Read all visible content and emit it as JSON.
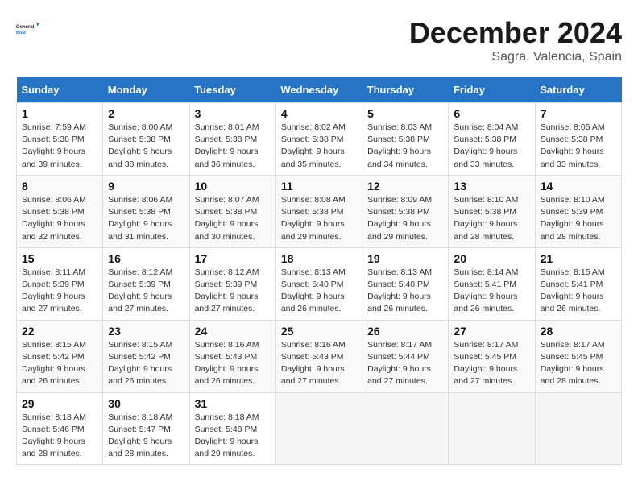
{
  "header": {
    "logo_line1": "General",
    "logo_line2": "Blue",
    "month": "December 2024",
    "location": "Sagra, Valencia, Spain"
  },
  "weekdays": [
    "Sunday",
    "Monday",
    "Tuesday",
    "Wednesday",
    "Thursday",
    "Friday",
    "Saturday"
  ],
  "weeks": [
    [
      {
        "day": "1",
        "info": "Sunrise: 7:59 AM\nSunset: 5:38 PM\nDaylight: 9 hours\nand 39 minutes."
      },
      {
        "day": "2",
        "info": "Sunrise: 8:00 AM\nSunset: 5:38 PM\nDaylight: 9 hours\nand 38 minutes."
      },
      {
        "day": "3",
        "info": "Sunrise: 8:01 AM\nSunset: 5:38 PM\nDaylight: 9 hours\nand 36 minutes."
      },
      {
        "day": "4",
        "info": "Sunrise: 8:02 AM\nSunset: 5:38 PM\nDaylight: 9 hours\nand 35 minutes."
      },
      {
        "day": "5",
        "info": "Sunrise: 8:03 AM\nSunset: 5:38 PM\nDaylight: 9 hours\nand 34 minutes."
      },
      {
        "day": "6",
        "info": "Sunrise: 8:04 AM\nSunset: 5:38 PM\nDaylight: 9 hours\nand 33 minutes."
      },
      {
        "day": "7",
        "info": "Sunrise: 8:05 AM\nSunset: 5:38 PM\nDaylight: 9 hours\nand 33 minutes."
      }
    ],
    [
      {
        "day": "8",
        "info": "Sunrise: 8:06 AM\nSunset: 5:38 PM\nDaylight: 9 hours\nand 32 minutes."
      },
      {
        "day": "9",
        "info": "Sunrise: 8:06 AM\nSunset: 5:38 PM\nDaylight: 9 hours\nand 31 minutes."
      },
      {
        "day": "10",
        "info": "Sunrise: 8:07 AM\nSunset: 5:38 PM\nDaylight: 9 hours\nand 30 minutes."
      },
      {
        "day": "11",
        "info": "Sunrise: 8:08 AM\nSunset: 5:38 PM\nDaylight: 9 hours\nand 29 minutes."
      },
      {
        "day": "12",
        "info": "Sunrise: 8:09 AM\nSunset: 5:38 PM\nDaylight: 9 hours\nand 29 minutes."
      },
      {
        "day": "13",
        "info": "Sunrise: 8:10 AM\nSunset: 5:38 PM\nDaylight: 9 hours\nand 28 minutes."
      },
      {
        "day": "14",
        "info": "Sunrise: 8:10 AM\nSunset: 5:39 PM\nDaylight: 9 hours\nand 28 minutes."
      }
    ],
    [
      {
        "day": "15",
        "info": "Sunrise: 8:11 AM\nSunset: 5:39 PM\nDaylight: 9 hours\nand 27 minutes."
      },
      {
        "day": "16",
        "info": "Sunrise: 8:12 AM\nSunset: 5:39 PM\nDaylight: 9 hours\nand 27 minutes."
      },
      {
        "day": "17",
        "info": "Sunrise: 8:12 AM\nSunset: 5:39 PM\nDaylight: 9 hours\nand 27 minutes."
      },
      {
        "day": "18",
        "info": "Sunrise: 8:13 AM\nSunset: 5:40 PM\nDaylight: 9 hours\nand 26 minutes."
      },
      {
        "day": "19",
        "info": "Sunrise: 8:13 AM\nSunset: 5:40 PM\nDaylight: 9 hours\nand 26 minutes."
      },
      {
        "day": "20",
        "info": "Sunrise: 8:14 AM\nSunset: 5:41 PM\nDaylight: 9 hours\nand 26 minutes."
      },
      {
        "day": "21",
        "info": "Sunrise: 8:15 AM\nSunset: 5:41 PM\nDaylight: 9 hours\nand 26 minutes."
      }
    ],
    [
      {
        "day": "22",
        "info": "Sunrise: 8:15 AM\nSunset: 5:42 PM\nDaylight: 9 hours\nand 26 minutes."
      },
      {
        "day": "23",
        "info": "Sunrise: 8:15 AM\nSunset: 5:42 PM\nDaylight: 9 hours\nand 26 minutes."
      },
      {
        "day": "24",
        "info": "Sunrise: 8:16 AM\nSunset: 5:43 PM\nDaylight: 9 hours\nand 26 minutes."
      },
      {
        "day": "25",
        "info": "Sunrise: 8:16 AM\nSunset: 5:43 PM\nDaylight: 9 hours\nand 27 minutes."
      },
      {
        "day": "26",
        "info": "Sunrise: 8:17 AM\nSunset: 5:44 PM\nDaylight: 9 hours\nand 27 minutes."
      },
      {
        "day": "27",
        "info": "Sunrise: 8:17 AM\nSunset: 5:45 PM\nDaylight: 9 hours\nand 27 minutes."
      },
      {
        "day": "28",
        "info": "Sunrise: 8:17 AM\nSunset: 5:45 PM\nDaylight: 9 hours\nand 28 minutes."
      }
    ],
    [
      {
        "day": "29",
        "info": "Sunrise: 8:18 AM\nSunset: 5:46 PM\nDaylight: 9 hours\nand 28 minutes."
      },
      {
        "day": "30",
        "info": "Sunrise: 8:18 AM\nSunset: 5:47 PM\nDaylight: 9 hours\nand 28 minutes."
      },
      {
        "day": "31",
        "info": "Sunrise: 8:18 AM\nSunset: 5:48 PM\nDaylight: 9 hours\nand 29 minutes."
      },
      {
        "day": "",
        "info": ""
      },
      {
        "day": "",
        "info": ""
      },
      {
        "day": "",
        "info": ""
      },
      {
        "day": "",
        "info": ""
      }
    ]
  ]
}
